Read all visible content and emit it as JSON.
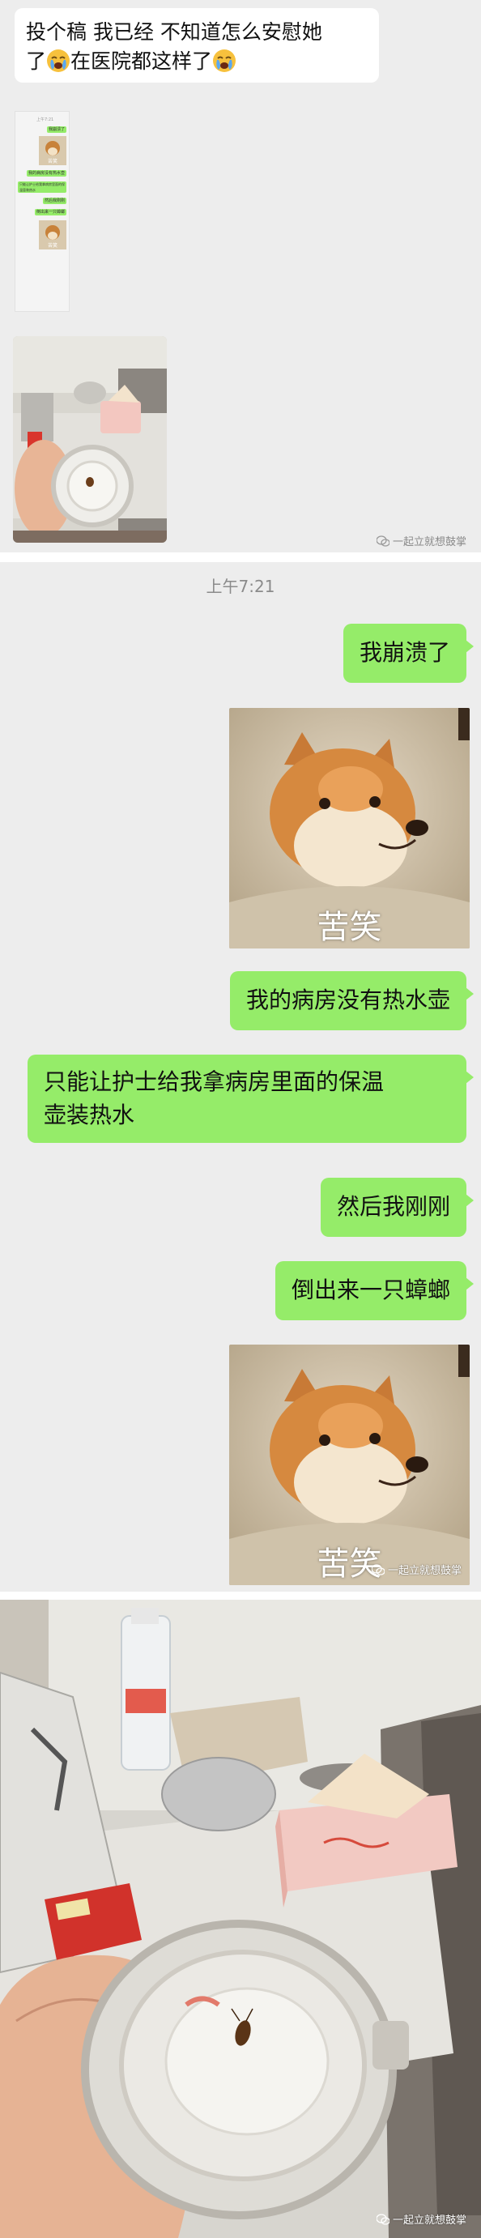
{
  "top_chat": {
    "message": "投个稿 我已经 不知道怎么安慰她了😭在医院都这样了😭",
    "message_line1": "投个稿 我已经 不知道怎么安慰她",
    "message_line2_a": "了",
    "message_line2_b": "在医院都这样了"
  },
  "thumbnail_chat": {
    "time": "上午7:21",
    "msg1": "我崩溃了",
    "sticker_caption": "苦笑",
    "msg2": "我的病房没有热水壶",
    "msg3": "只能让护士给我拿病房里面的保温壶装热水",
    "msg4": "然后我刚刚",
    "msg5": "倒出来一只蟑螂",
    "sticker2_caption": "苦笑"
  },
  "watermark": {
    "text": "一起立就想鼓掌"
  },
  "main_chat": {
    "time": "上午7:21",
    "messages": [
      {
        "text": "我崩溃了"
      },
      {
        "text": "我的病房没有热水壶"
      },
      {
        "text": "只能让护士给我拿病房里面的保温壶装热水",
        "line1": "只能让护士给我拿病房里面的保温",
        "line2": "壶装热水"
      },
      {
        "text": "然后我刚刚"
      },
      {
        "text": "倒出来一只蟑螂"
      }
    ],
    "sticker_caption_1": "苦笑",
    "sticker_caption_2": "苦笑"
  },
  "colors": {
    "chat_bg": "#ededed",
    "green_bubble": "#95ec69",
    "white_bubble": "#ffffff",
    "time_text": "#8b8b8b"
  },
  "icons": [
    "crying-emoji-icon",
    "wechat-watermark-icon"
  ]
}
